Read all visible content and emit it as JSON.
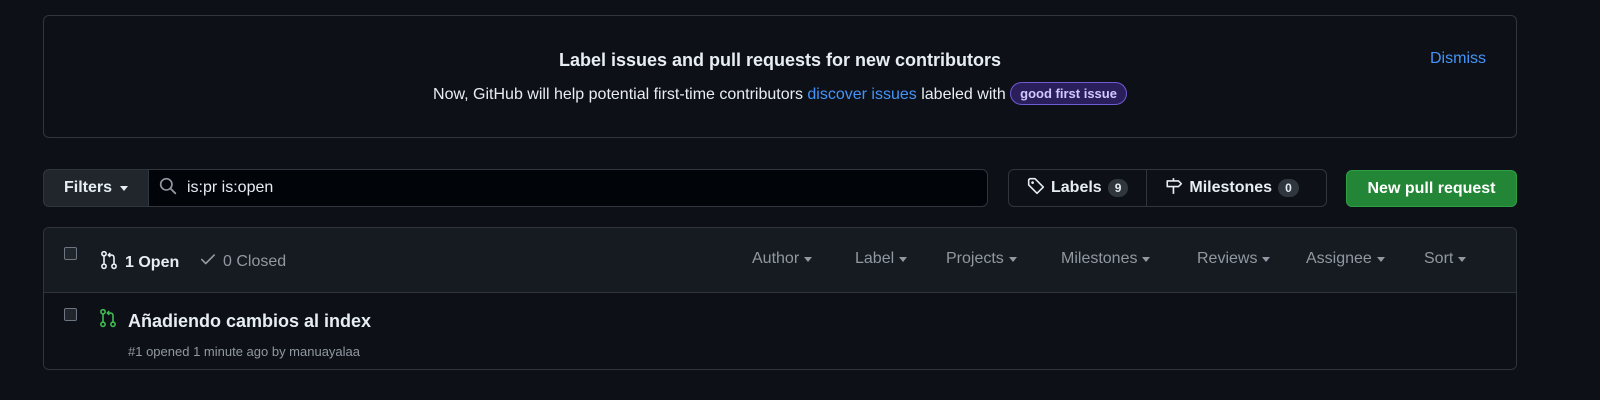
{
  "banner": {
    "title": "Label issues and pull requests for new contributors",
    "text_before": "Now, GitHub will help potential first-time contributors ",
    "link": "discover issues",
    "text_after": " labeled with ",
    "label": "good first issue",
    "dismiss": "Dismiss"
  },
  "toolbar": {
    "filters": "Filters",
    "search_value": "is:pr is:open",
    "labels": "Labels",
    "labels_count": "9",
    "milestones": "Milestones",
    "milestones_count": "0",
    "new_pr": "New pull request"
  },
  "list_header": {
    "open": "1 Open",
    "closed": "0 Closed",
    "filters": [
      "Author",
      "Label",
      "Projects",
      "Milestones",
      "Reviews",
      "Assignee",
      "Sort"
    ]
  },
  "pull_requests": [
    {
      "title": "Añadiendo cambios al index",
      "meta": "#1 opened 1 minute ago by manuayalaa"
    }
  ],
  "colors": {
    "background": "#0d1117",
    "link": "#4493f8",
    "open_icon": "#3fb950",
    "primary_button": "#238636"
  }
}
